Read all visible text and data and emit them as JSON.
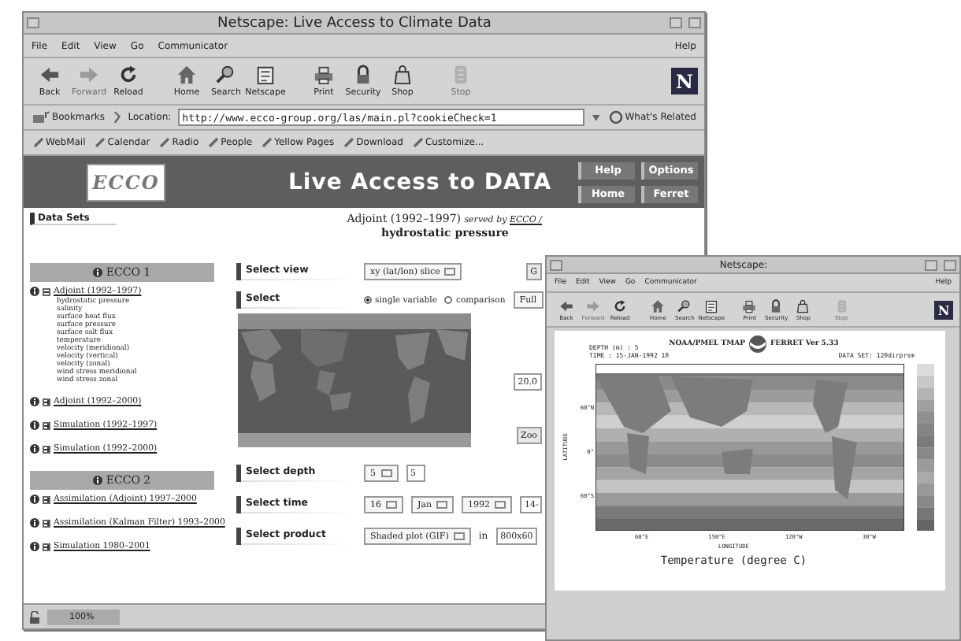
{
  "main_window": {
    "title": "Netscape: Live Access to Climate Data",
    "menu": [
      "File",
      "Edit",
      "View",
      "Go",
      "Communicator"
    ],
    "menu_right": "Help",
    "toolbar": [
      {
        "label": "Back",
        "disabled": false
      },
      {
        "label": "Forward",
        "disabled": true
      },
      {
        "label": "Reload",
        "disabled": false
      },
      {
        "label": "Home",
        "disabled": false
      },
      {
        "label": "Search",
        "disabled": false
      },
      {
        "label": "Netscape",
        "disabled": false
      },
      {
        "label": "Print",
        "disabled": false
      },
      {
        "label": "Security",
        "disabled": false
      },
      {
        "label": "Shop",
        "disabled": false
      },
      {
        "label": "Stop",
        "disabled": true
      }
    ],
    "brand_logo": "N",
    "location_bar": {
      "bookmarks": "Bookmarks",
      "label": "Location:",
      "url": "http://www.ecco-group.org/las/main.pl?cookieCheck=1",
      "related": "What's Related"
    },
    "personal_toolbar": [
      "WebMail",
      "Calendar",
      "Radio",
      "People",
      "Yellow Pages",
      "Download",
      "Customize..."
    ],
    "page": {
      "logo": "ECCO",
      "title": "Live Access to DATA",
      "nav_buttons": [
        "Help",
        "Options",
        "Home",
        "Ferret"
      ],
      "sidebar": {
        "heading": "Data Sets",
        "groups": [
          {
            "title": "ECCO 1",
            "items": [
              {
                "label": "Adjoint (1992–1997)",
                "expanded": true,
                "children": [
                  {
                    "label": "hydrostatic pressure"
                  },
                  {
                    "label": "salinity"
                  },
                  {
                    "label": "surface heat flux"
                  },
                  {
                    "label": "surface pressure"
                  },
                  {
                    "label": "surface salt flux"
                  },
                  {
                    "label": "temperature"
                  },
                  {
                    "label": "velocity (meridional)"
                  },
                  {
                    "label": "velocity (vertical)"
                  },
                  {
                    "label": "velocity (zonal)"
                  },
                  {
                    "label": "wind stress meridional"
                  },
                  {
                    "label": "wind stress zonal"
                  }
                ]
              },
              {
                "label": "Adjoint (1992–2000)",
                "expanded": false
              },
              {
                "label": "Simulation (1992–1997)",
                "expanded": false
              },
              {
                "label": "Simulation (1992–2000)",
                "expanded": false
              }
            ]
          },
          {
            "title": "ECCO 2",
            "items": [
              {
                "label": "Assimilation (Adjoint) 1997–2000",
                "expanded": false
              },
              {
                "label": "Assimilation (Kalman Filter) 1993–2000",
                "expanded": false
              },
              {
                "label": "Simulation 1980–2001",
                "expanded": false
              }
            ]
          }
        ]
      },
      "dataset": {
        "name": "Adjoint (1992–1997)",
        "served_by": "served by",
        "server": "ECCO /",
        "variable": "hydrostatic pressure"
      },
      "top_controls": [
        {
          "kind": "fields",
          "label": "Select view",
          "fields": [
            {
              "kind": "dropdown",
              "value": "xy (lat/lon) slice"
            }
          ]
        },
        {
          "kind": "radios",
          "label": "Select",
          "options": [
            {
              "label": "single variable",
              "selected": true
            },
            {
              "label": "comparison",
              "selected": false
            }
          ]
        }
      ],
      "map": {
        "kind": "picture"
      },
      "bottom_controls": [
        {
          "kind": "fields",
          "label": "Select depth",
          "fields": [
            {
              "kind": "dropdown",
              "value": "5"
            },
            {
              "kind": "text",
              "value": "5"
            }
          ]
        },
        {
          "kind": "fields",
          "label": "Select time",
          "fields": [
            {
              "kind": "dropdown",
              "value": "16"
            },
            {
              "kind": "dropdown",
              "value": "Jan"
            },
            {
              "kind": "dropdown",
              "value": "1992"
            },
            {
              "kind": "text",
              "value": "14-"
            }
          ]
        },
        {
          "kind": "fields",
          "label": "Select product",
          "fields": [
            {
              "kind": "dropdown",
              "value": "Shaded plot (GIF)"
            },
            {
              "kind": "label",
              "value": "in"
            },
            {
              "kind": "text",
              "value": "800x60"
            }
          ]
        }
      ],
      "side_controls": [
        {
          "kind": "button",
          "value": "G"
        },
        {
          "kind": "dropdown",
          "value": "Full"
        },
        {
          "kind": "text",
          "value": "20.0"
        },
        {
          "kind": "button",
          "value": "Zoo"
        }
      ],
      "status": {
        "zoom": "100%"
      }
    }
  },
  "plot_window": {
    "title": "Netscape:",
    "menu": [
      "File",
      "Edit",
      "View",
      "Go",
      "Communicator"
    ],
    "menu_right": "Help",
    "toolbar": [
      {
        "label": "Back",
        "disabled": false
      },
      {
        "label": "Forward",
        "disabled": true
      },
      {
        "label": "Reload",
        "disabled": false
      },
      {
        "label": "Home",
        "disabled": false
      },
      {
        "label": "Search",
        "disabled": false
      },
      {
        "label": "Netscape",
        "disabled": false
      },
      {
        "label": "Print",
        "disabled": false
      },
      {
        "label": "Security",
        "disabled": false
      },
      {
        "label": "Shop",
        "disabled": false
      },
      {
        "label": "Stop",
        "disabled": true
      }
    ],
    "brand_logo": "N",
    "plot": {
      "header_left": "NOAA/PMEL TMAP",
      "header_right": "FERRET Ver 5.33",
      "depth": "DEPTH (m) : 5",
      "time": "TIME : 15-JAN-1992 10",
      "dataset": "DATA SET: 120dirprsm",
      "ylabel": "LATITUDE",
      "yticks": [
        "60°N",
        "0°",
        "60°S"
      ],
      "xlabel": "LONGITUDE",
      "xticks": [
        "60°E",
        "150°E",
        "120°W",
        "30°W"
      ],
      "title": "Temperature (degree C)"
    }
  }
}
